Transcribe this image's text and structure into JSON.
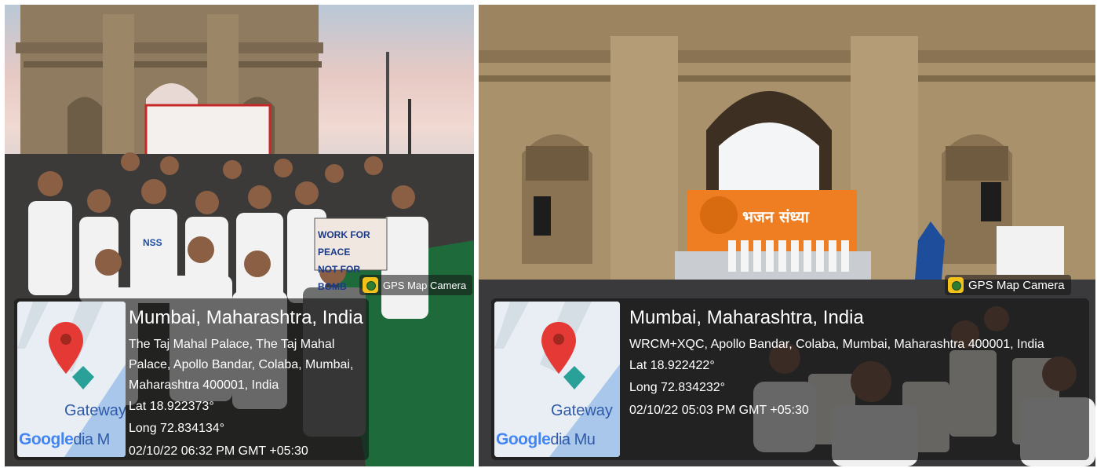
{
  "photos": [
    {
      "badge": "GPS Map Camera",
      "city": "Mumbai, Maharashtra, India",
      "address": "The Taj Mahal Palace, The Taj Mahal Palace, Apollo Bandar, Colaba, Mumbai, Maharashtra 400001, India",
      "lat": "Lat 18.922373°",
      "long": "Long 72.834134°",
      "datetime": "02/10/22 06:32 PM GMT +05:30",
      "map_label": "Gateway",
      "google_text": "Google",
      "map_suffix": "dia M",
      "banner_text_1": "WORK FOR PEACE",
      "banner_text_2": "NOT FOR BOMB",
      "shirt_text": "NSS"
    },
    {
      "badge": "GPS Map Camera",
      "city": "Mumbai, Maharashtra, India",
      "address": "WRCM+XQC, Apollo Bandar, Colaba, Mumbai, Maharashtra 400001, India",
      "lat": "Lat 18.922422°",
      "long": "Long 72.834232°",
      "datetime": "02/10/22 05:03 PM GMT +05:30",
      "map_label": "Gateway",
      "google_text": "Google",
      "map_suffix": "dia Mu",
      "stage_banner_text": "भजन संध्या"
    }
  ],
  "colors": {
    "pin_red": "#e53935",
    "pin_teal": "#2aa198",
    "water": "#a8c7ea",
    "land": "#e8eef3",
    "stone": "#a38c6a",
    "sky_left": "#d9c3c0",
    "sky_right": "#f1f3f5"
  }
}
